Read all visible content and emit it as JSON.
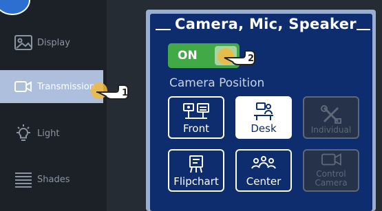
{
  "sidebar": {
    "items": [
      {
        "label": "Display",
        "icon": "image-icon"
      },
      {
        "label": "Transmission",
        "icon": "video-camera-icon",
        "active": true
      },
      {
        "label": "Light",
        "icon": "light-bulb-icon"
      },
      {
        "label": "Shades",
        "icon": "shades-icon"
      }
    ]
  },
  "panel": {
    "title": "Camera, Mic, Speaker",
    "toggle": {
      "label": "ON",
      "state": "on"
    },
    "section_label": "Camera Position",
    "positions": [
      {
        "label": "Front",
        "icon": "front-cameras-icon",
        "state": "normal"
      },
      {
        "label": "Desk",
        "icon": "desk-icon",
        "state": "selected"
      },
      {
        "label": "Individual",
        "icon": "tools-icon",
        "state": "disabled"
      },
      {
        "label": "Flipchart",
        "icon": "flipchart-icon",
        "state": "normal"
      },
      {
        "label": "Center",
        "icon": "group-icon",
        "state": "normal"
      },
      {
        "label": "Control Camera",
        "icon": "camera-control-icon",
        "state": "disabled"
      }
    ]
  },
  "annotations": [
    {
      "number": "1",
      "target": "Transmission"
    },
    {
      "number": "2",
      "target": "ON"
    }
  ],
  "colors": {
    "panel_bg": "#0e2d6e",
    "accent_green": "#42a947",
    "active_nav": "#aebfde",
    "pointer_yellow": "#f2b83b"
  }
}
